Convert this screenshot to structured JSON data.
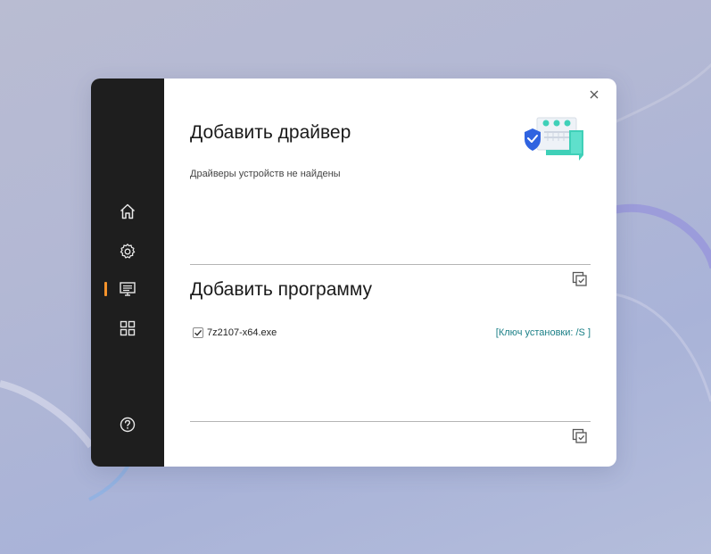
{
  "dialog": {
    "close_icon": "close-icon",
    "driver_section": {
      "title": "Добавить драйвер",
      "status": "Драйверы устройств не найдены",
      "illustration": "driver-shield-illustration",
      "action_icon": "copy-check-icon"
    },
    "program_section": {
      "title": "Добавить программу",
      "programs": [
        {
          "name": "7z2107-x64.exe",
          "checked": true,
          "install_key": "[Ключ установки: /S ]"
        }
      ],
      "action_icon": "copy-check-icon"
    }
  },
  "sidebar": {
    "items": [
      {
        "name": "home",
        "icon": "home-icon",
        "active": false
      },
      {
        "name": "settings",
        "icon": "gear-icon",
        "active": false
      },
      {
        "name": "drivers",
        "icon": "monitor-list-icon",
        "active": true
      },
      {
        "name": "apps",
        "icon": "grid-icon",
        "active": false
      },
      {
        "name": "help",
        "icon": "help-icon",
        "active": false
      }
    ]
  },
  "colors": {
    "sidebar_bg": "#1e1e1e",
    "accent": "#f5932b",
    "link": "#1a7f86",
    "shield_blue": "#2f63e0",
    "teal": "#3fd0b8"
  }
}
